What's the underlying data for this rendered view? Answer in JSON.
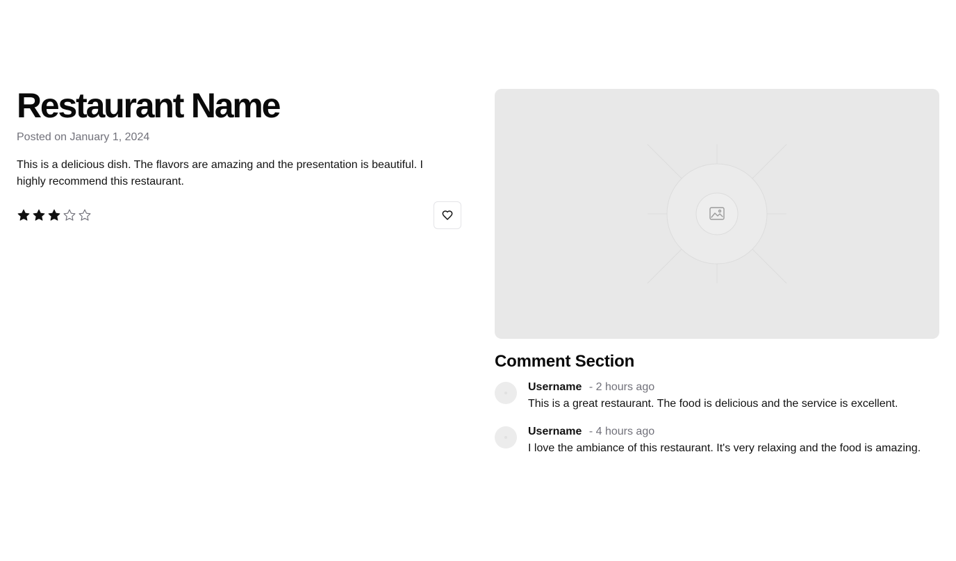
{
  "post": {
    "title": "Restaurant Name",
    "posted": "Posted on January 1, 2024",
    "description": "This is a delicious dish. The flavors are amazing and the presentation is beautiful. I highly recommend this restaurant.",
    "rating": 3,
    "rating_max": 5,
    "favorite_icon": "heart-icon"
  },
  "image": {
    "placeholder_icon": "image-placeholder-icon"
  },
  "comments": {
    "title": "Comment Section",
    "items": [
      {
        "username": "Username",
        "time": "- 2 hours ago",
        "text": "This is a great restaurant. The food is delicious and the service is excellent."
      },
      {
        "username": "Username",
        "time": "- 4 hours ago",
        "text": "I love the ambiance of this restaurant. It's very relaxing and the food is amazing."
      }
    ]
  },
  "colors": {
    "star_filled": "#111111",
    "star_empty": "#71717a",
    "muted_text": "#71717a",
    "placeholder_bg": "#e8e8e8"
  }
}
